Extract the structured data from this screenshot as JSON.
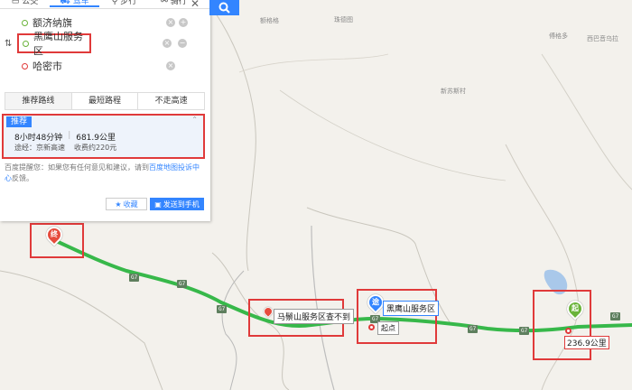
{
  "modes": [
    {
      "label": "公交",
      "icon": "bus-icon"
    },
    {
      "label": "驾车",
      "icon": "car-icon"
    },
    {
      "label": "步行",
      "icon": "walk-icon"
    },
    {
      "label": "骑行",
      "icon": "bike-icon"
    }
  ],
  "waypoints": {
    "start": "额济纳旗",
    "via": "黑鹰山服务区",
    "end": "哈密市"
  },
  "tabs": [
    "推荐路线",
    "最短路程",
    "不走高速"
  ],
  "route": {
    "badge": "推荐",
    "duration": "8小时48分钟",
    "distance": "681.9公里",
    "via_label": "途经：京新高速",
    "toll": "收费约220元"
  },
  "advice": {
    "prefix": "百度提醒您：如果您有任何意见和建议，请到",
    "link": "百度地图投诉中心",
    "suffix": "反馈。"
  },
  "buttons": {
    "favorite": "收藏",
    "send": "发送到手机"
  },
  "map": {
    "labels": [
      "额格格",
      "珠德图",
      "傅格多",
      "西巴音乌拉",
      "新苏斯村"
    ],
    "highway": "G7",
    "markers": {
      "end_pin": "终",
      "via_pin": "途",
      "start_pin": "起",
      "mazong_tag": "马鬃山服务区查不到",
      "heiying_tag": "黑鹰山服务区",
      "start_label": "起点",
      "distance_label": "236.9公里"
    }
  },
  "colors": {
    "accent": "#3385ff",
    "route": "#37b84a",
    "highlight": "#e03a3a"
  }
}
